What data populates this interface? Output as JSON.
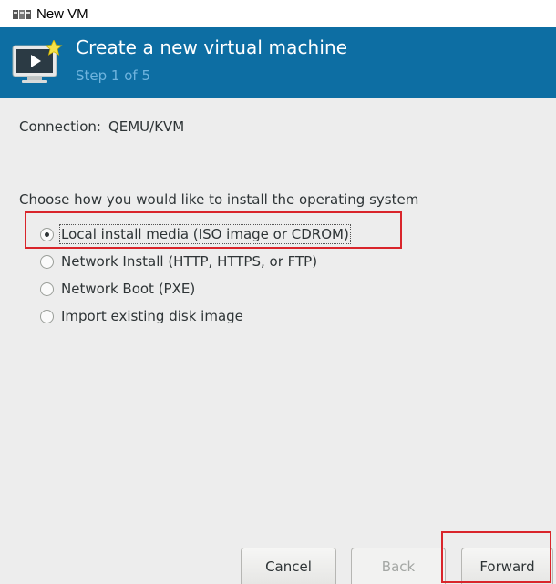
{
  "window": {
    "title": "New VM",
    "icon": "virt-manager-icon"
  },
  "header": {
    "title": "Create a new virtual machine",
    "step": "Step 1 of 5",
    "background_color": "#0d6ea3",
    "icon": "monitor-new-icon"
  },
  "connection": {
    "label": "Connection:",
    "value": "QEMU/KVM"
  },
  "install": {
    "prompt": "Choose how you would like to install the operating system",
    "options": [
      {
        "label": "Local install media (ISO image or CDROM)",
        "selected": true
      },
      {
        "label": "Network Install (HTTP, HTTPS, or FTP)",
        "selected": false
      },
      {
        "label": "Network Boot (PXE)",
        "selected": false
      },
      {
        "label": "Import existing disk image",
        "selected": false
      }
    ]
  },
  "buttons": {
    "cancel": "Cancel",
    "back": "Back",
    "forward": "Forward"
  },
  "annotation_color": "#d9252b"
}
